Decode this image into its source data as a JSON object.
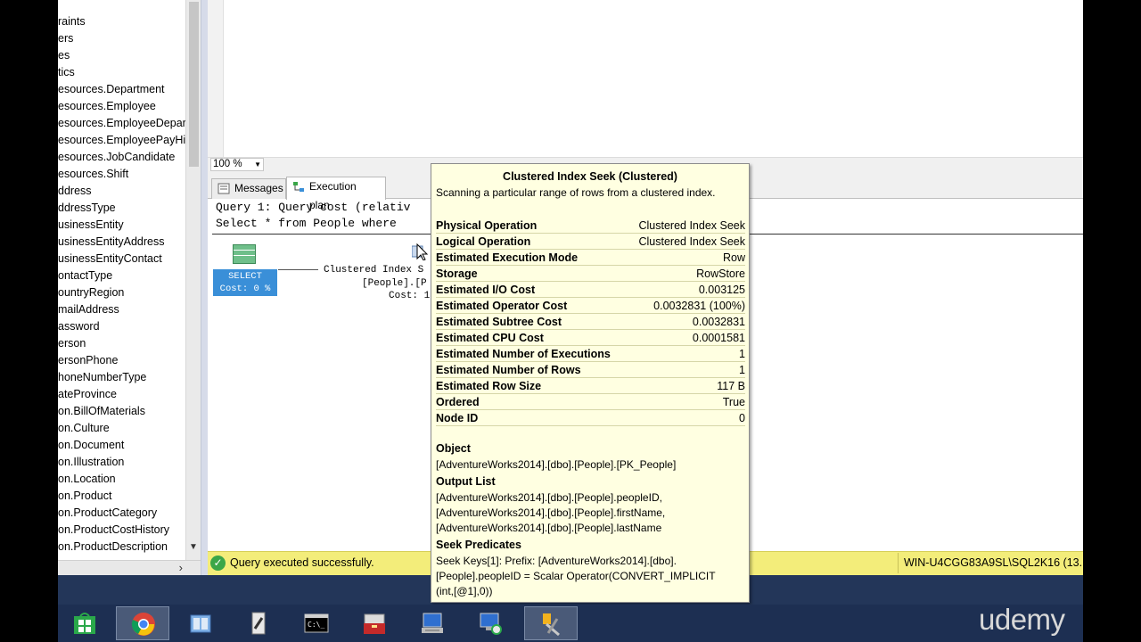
{
  "explorer": {
    "items": [
      "raints",
      "ers",
      "es",
      "tics",
      "esources.Department",
      "esources.Employee",
      "esources.EmployeeDepart",
      "esources.EmployeePayHis",
      "esources.JobCandidate",
      "esources.Shift",
      "ddress",
      "ddressType",
      "usinessEntity",
      "usinessEntityAddress",
      "usinessEntityContact",
      "ontactType",
      "ountryRegion",
      "mailAddress",
      "assword",
      "erson",
      "ersonPhone",
      "honeNumberType",
      "ateProvince",
      "on.BillOfMaterials",
      "on.Culture",
      "on.Document",
      "on.Illustration",
      "on.Location",
      "on.Product",
      "on.ProductCategory",
      "on.ProductCostHistory",
      "on.ProductDescription"
    ]
  },
  "editor": {
    "zoom": "100 %"
  },
  "results": {
    "tabs": [
      {
        "label": "Messages",
        "icon": "messages-icon"
      },
      {
        "label": "Execution plan",
        "icon": "execution-plan-icon"
      }
    ],
    "query_line1": "Query 1: Query cost (relativ",
    "query_line2": "Select * from People where ",
    "select_label": "SELECT",
    "select_cost": "Cost: 0 %",
    "seek_line1": "Clustered Index S",
    "seek_line2": "[People].[P",
    "seek_line3": "Cost: 1"
  },
  "tooltip": {
    "title": "Clustered Index Seek (Clustered)",
    "description": "Scanning a particular range of rows from a clustered index.",
    "properties": [
      {
        "key": "Physical Operation",
        "value": "Clustered Index Seek"
      },
      {
        "key": "Logical Operation",
        "value": "Clustered Index Seek"
      },
      {
        "key": "Estimated Execution Mode",
        "value": "Row"
      },
      {
        "key": "Storage",
        "value": "RowStore"
      },
      {
        "key": "Estimated I/O Cost",
        "value": "0.003125"
      },
      {
        "key": "Estimated Operator Cost",
        "value": "0.0032831 (100%)"
      },
      {
        "key": "Estimated Subtree Cost",
        "value": "0.0032831"
      },
      {
        "key": "Estimated CPU Cost",
        "value": "0.0001581"
      },
      {
        "key": "Estimated Number of Executions",
        "value": "1"
      },
      {
        "key": "Estimated Number of Rows",
        "value": "1"
      },
      {
        "key": "Estimated Row Size",
        "value": "117 B"
      },
      {
        "key": "Ordered",
        "value": "True"
      },
      {
        "key": "Node ID",
        "value": "0"
      }
    ],
    "object_head": "Object",
    "object_value": "[AdventureWorks2014].[dbo].[People].[PK_People]",
    "output_head": "Output List",
    "output_lines": [
      "[AdventureWorks2014].[dbo].[People].peopleID,",
      "[AdventureWorks2014].[dbo].[People].firstName,",
      "[AdventureWorks2014].[dbo].[People].lastName"
    ],
    "seek_head": "Seek Predicates",
    "seek_lines": [
      "Seek Keys[1]: Prefix: [AdventureWorks2014].[dbo].",
      "[People].peopleID = Scalar Operator(CONVERT_IMPLICIT",
      "(int,[@1],0))"
    ]
  },
  "status": {
    "message": "Query executed successfully.",
    "server": "WIN-U4CGG83A9SL\\SQL2K16 (13..."
  },
  "taskbar": {
    "apps": [
      "store-icon",
      "chrome-icon",
      "explorer-icon",
      "ssms-config-icon",
      "cmd-icon",
      "toolbox-icon",
      "network-icon",
      "remote-desktop-icon",
      "ssms-icon"
    ]
  },
  "watermark": "udemy",
  "colors": {
    "status_bar": "#f3ed7a",
    "tooltip_bg": "#ffffe1",
    "select_box": "#3a8fd8",
    "taskbar": "#1d2f52"
  }
}
